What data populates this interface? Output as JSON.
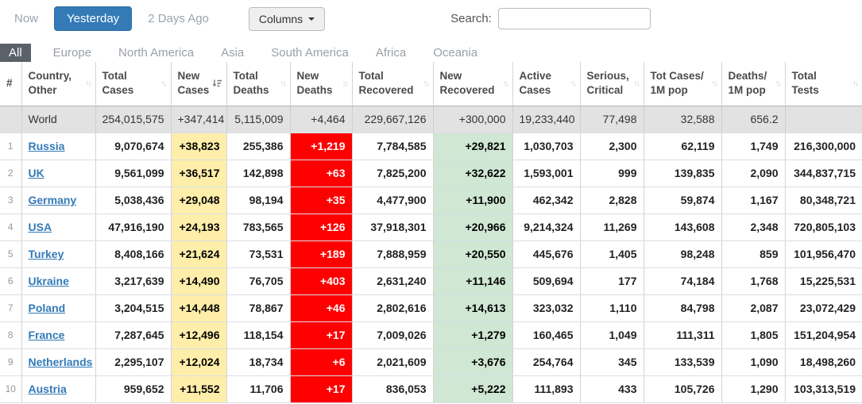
{
  "toolbar": {
    "date_buttons": [
      {
        "label": "Now",
        "active": false
      },
      {
        "label": "Yesterday",
        "active": true
      },
      {
        "label": "2 Days Ago",
        "active": false
      }
    ],
    "columns_button": "Columns",
    "search_label": "Search:",
    "search_value": ""
  },
  "region_tabs": [
    {
      "label": "All",
      "active": true
    },
    {
      "label": "Europe",
      "active": false
    },
    {
      "label": "North America",
      "active": false
    },
    {
      "label": "Asia",
      "active": false
    },
    {
      "label": "South America",
      "active": false
    },
    {
      "label": "Africa",
      "active": false
    },
    {
      "label": "Oceania",
      "active": false
    }
  ],
  "colors": {
    "accent_blue": "#337ab7",
    "new_cases_yellow": "#FFEEAA",
    "new_deaths_red": "#FF0000",
    "new_recovered_green": "#cfe7d3",
    "world_row_gray": "#e2e2e2",
    "country_link_blue": "#337ab7"
  },
  "table": {
    "columns": [
      {
        "key": "num",
        "label": "#",
        "sortable": false
      },
      {
        "key": "country",
        "label": "Country,\nOther",
        "sortable": true
      },
      {
        "key": "total_cases",
        "label": "Total\nCases",
        "sortable": true
      },
      {
        "key": "new_cases",
        "label": "New\nCases",
        "sortable": true,
        "sorted": "desc"
      },
      {
        "key": "total_deaths",
        "label": "Total\nDeaths",
        "sortable": true
      },
      {
        "key": "new_deaths",
        "label": "New\nDeaths",
        "sortable": true
      },
      {
        "key": "total_recovered",
        "label": "Total\nRecovered",
        "sortable": true
      },
      {
        "key": "new_recovered",
        "label": "New\nRecovered",
        "sortable": true
      },
      {
        "key": "active_cases",
        "label": "Active\nCases",
        "sortable": true
      },
      {
        "key": "serious_critical",
        "label": "Serious,\nCritical",
        "sortable": true
      },
      {
        "key": "cases_per_1m",
        "label": "Tot Cases/\n1M pop",
        "sortable": true
      },
      {
        "key": "deaths_per_1m",
        "label": "Deaths/\n1M pop",
        "sortable": true
      },
      {
        "key": "total_tests",
        "label": "Total\nTests",
        "sortable": true
      }
    ],
    "world_row": {
      "num": "",
      "country": "World",
      "total_cases": "254,015,575",
      "new_cases": "+347,414",
      "total_deaths": "5,115,009",
      "new_deaths": "+4,464",
      "total_recovered": "229,667,126",
      "new_recovered": "+300,000",
      "active_cases": "19,233,440",
      "serious_critical": "77,498",
      "cases_per_1m": "32,588",
      "deaths_per_1m": "656.2",
      "total_tests": ""
    },
    "rows": [
      {
        "num": "1",
        "country": "Russia",
        "total_cases": "9,070,674",
        "new_cases": "+38,823",
        "total_deaths": "255,386",
        "new_deaths": "+1,219",
        "total_recovered": "7,784,585",
        "new_recovered": "+29,821",
        "active_cases": "1,030,703",
        "serious_critical": "2,300",
        "cases_per_1m": "62,119",
        "deaths_per_1m": "1,749",
        "total_tests": "216,300,000"
      },
      {
        "num": "2",
        "country": "UK",
        "total_cases": "9,561,099",
        "new_cases": "+36,517",
        "total_deaths": "142,898",
        "new_deaths": "+63",
        "total_recovered": "7,825,200",
        "new_recovered": "+32,622",
        "active_cases": "1,593,001",
        "serious_critical": "999",
        "cases_per_1m": "139,835",
        "deaths_per_1m": "2,090",
        "total_tests": "344,837,715"
      },
      {
        "num": "3",
        "country": "Germany",
        "total_cases": "5,038,436",
        "new_cases": "+29,048",
        "total_deaths": "98,194",
        "new_deaths": "+35",
        "total_recovered": "4,477,900",
        "new_recovered": "+11,900",
        "active_cases": "462,342",
        "serious_critical": "2,828",
        "cases_per_1m": "59,874",
        "deaths_per_1m": "1,167",
        "total_tests": "80,348,721"
      },
      {
        "num": "4",
        "country": "USA",
        "total_cases": "47,916,190",
        "new_cases": "+24,193",
        "total_deaths": "783,565",
        "new_deaths": "+126",
        "total_recovered": "37,918,301",
        "new_recovered": "+20,966",
        "active_cases": "9,214,324",
        "serious_critical": "11,269",
        "cases_per_1m": "143,608",
        "deaths_per_1m": "2,348",
        "total_tests": "720,805,103"
      },
      {
        "num": "5",
        "country": "Turkey",
        "total_cases": "8,408,166",
        "new_cases": "+21,624",
        "total_deaths": "73,531",
        "new_deaths": "+189",
        "total_recovered": "7,888,959",
        "new_recovered": "+20,550",
        "active_cases": "445,676",
        "serious_critical": "1,405",
        "cases_per_1m": "98,248",
        "deaths_per_1m": "859",
        "total_tests": "101,956,470"
      },
      {
        "num": "6",
        "country": "Ukraine",
        "total_cases": "3,217,639",
        "new_cases": "+14,490",
        "total_deaths": "76,705",
        "new_deaths": "+403",
        "total_recovered": "2,631,240",
        "new_recovered": "+11,146",
        "active_cases": "509,694",
        "serious_critical": "177",
        "cases_per_1m": "74,184",
        "deaths_per_1m": "1,768",
        "total_tests": "15,225,531"
      },
      {
        "num": "7",
        "country": "Poland",
        "total_cases": "3,204,515",
        "new_cases": "+14,448",
        "total_deaths": "78,867",
        "new_deaths": "+46",
        "total_recovered": "2,802,616",
        "new_recovered": "+14,613",
        "active_cases": "323,032",
        "serious_critical": "1,110",
        "cases_per_1m": "84,798",
        "deaths_per_1m": "2,087",
        "total_tests": "23,072,429"
      },
      {
        "num": "8",
        "country": "France",
        "total_cases": "7,287,645",
        "new_cases": "+12,496",
        "total_deaths": "118,154",
        "new_deaths": "+17",
        "total_recovered": "7,009,026",
        "new_recovered": "+1,279",
        "active_cases": "160,465",
        "serious_critical": "1,049",
        "cases_per_1m": "111,311",
        "deaths_per_1m": "1,805",
        "total_tests": "151,204,954"
      },
      {
        "num": "9",
        "country": "Netherlands",
        "total_cases": "2,295,107",
        "new_cases": "+12,024",
        "total_deaths": "18,734",
        "new_deaths": "+6",
        "total_recovered": "2,021,609",
        "new_recovered": "+3,676",
        "active_cases": "254,764",
        "serious_critical": "345",
        "cases_per_1m": "133,539",
        "deaths_per_1m": "1,090",
        "total_tests": "18,498,260"
      },
      {
        "num": "10",
        "country": "Austria",
        "total_cases": "959,652",
        "new_cases": "+11,552",
        "total_deaths": "11,706",
        "new_deaths": "+17",
        "total_recovered": "836,053",
        "new_recovered": "+5,222",
        "active_cases": "111,893",
        "serious_critical": "433",
        "cases_per_1m": "105,726",
        "deaths_per_1m": "1,290",
        "total_tests": "103,313,519"
      }
    ]
  }
}
